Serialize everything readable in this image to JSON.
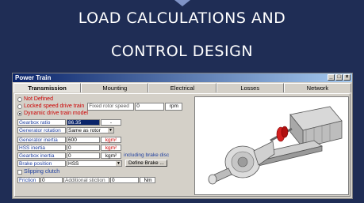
{
  "banner": {
    "line1": "LOAD CALCULATIONS AND",
    "line2": "CONTROL DESIGN"
  },
  "window": {
    "title": "Power Train",
    "controls": [
      "_",
      "□",
      "×"
    ]
  },
  "tabs": [
    {
      "label": "Transmission",
      "active": true
    },
    {
      "label": "Mounting",
      "active": false
    },
    {
      "label": "Electrical",
      "active": false
    },
    {
      "label": "Losses",
      "active": false
    },
    {
      "label": "Network",
      "active": false
    }
  ],
  "model_options": [
    {
      "label": "Not Defined",
      "selected": false
    },
    {
      "label": "Locked speed drive train",
      "selected": false
    },
    {
      "label": "Dynamic drive train model",
      "selected": true
    }
  ],
  "fixed_rotor_speed": {
    "label": "Fixed rotor speed",
    "value": "0",
    "unit": "rpm"
  },
  "gearbox_ratio": {
    "label": "Gearbox ratio",
    "value": "86.35",
    "unit": "-"
  },
  "generator_rotation": {
    "label": "Generator rotation",
    "value": "Same as rotor"
  },
  "inertias": [
    {
      "label": "Generator inertia",
      "value": "600",
      "unit": "kgm²"
    },
    {
      "label": "HSS inertia",
      "value": "0",
      "unit": "kgm²"
    },
    {
      "label": "Gearbox inertia",
      "value": "0",
      "unit": "kgm²",
      "note": "including brake disc"
    }
  ],
  "brake_position": {
    "label": "Brake position",
    "value": "HSS",
    "button": "Define Brake ..."
  },
  "slipping_clutch": {
    "label": "Slipping clutch",
    "checked": false
  },
  "friction": {
    "label": "Friction",
    "value": "0",
    "stiction_label": "Additional stiction",
    "stiction_value": "0",
    "unit": "Nm"
  },
  "colors": {
    "banner_bg": "#1f2d55",
    "accent_red": "#cc0000",
    "label_blue": "#2040a0"
  }
}
